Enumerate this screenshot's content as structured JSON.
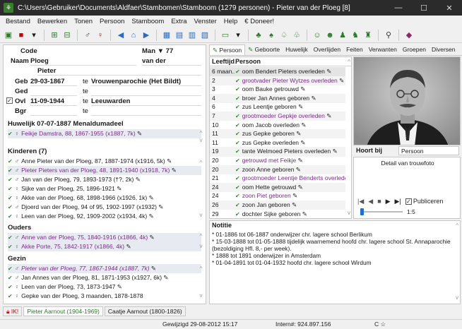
{
  "window": {
    "title": "C:\\Users\\Gebruiker\\Documents\\Aldfaer\\Stambomen\\Stamboom (1279 personen) - Pieter van der Ploeg [8]"
  },
  "menu": [
    "Bestand",
    "Bewerken",
    "Tonen",
    "Persoon",
    "Stamboom",
    "Extra",
    "Venster",
    "Help",
    "€ Doneer!"
  ],
  "person": {
    "code_label": "Code",
    "gender_age": "Man ▼ 77",
    "name_label": "Naam",
    "surname": "Ploeg",
    "prefix": "van der",
    "firstname": "Pieter",
    "birth_label": "Geb",
    "birth_date": "29-03-1867",
    "birth_te": "te",
    "birth_place": "Vrouwenparochie (Het Bildt)",
    "ged_label": "Ged",
    "ged_te": "te",
    "death_label": "Ovl",
    "death_date": "11-09-1944",
    "death_te": "te",
    "death_place": "Leeuwarden",
    "bgr_label": "Bgr",
    "bgr_te": "te"
  },
  "marriage": {
    "heading": "Huwelijk 07-07-1887 Menaldumadeel",
    "partner": "Feikje Damstra, 88, 1867-1955 (x1887, 7k)"
  },
  "children": {
    "heading": "Kinderen (7)",
    "items": [
      "Anne Pieter van der Ploeg, 87, 1887-1974 (x1916, 5k)",
      "Pieter Pieters van der Ploeg, 48, 1891-1940 (x1918, 7k)",
      "Jan van der Ploeg, 79, 1893-1973 (†?, 2k)",
      "Sijke van der Ploeg, 25, 1896-1921",
      "Akke van der Ploeg, 68, 1898-1966 (x1926, 1k)",
      "Djoerd van der Ploeg, 94 of 95, 1902-1997 (x1932)",
      "Leen van der Ploeg, 92, 1909-2002 (x1934, 4k)"
    ]
  },
  "parents": {
    "heading": "Ouders",
    "items": [
      "Anne van der Ploeg, 75, 1840-1916 (x1866, 4k)",
      "Akke Porte, 75, 1842-1917 (x1866, 4k)"
    ]
  },
  "family": {
    "heading": "Gezin",
    "items": [
      "Pieter van der Ploeg, 77, 1867-1944 (x1887, 7k)",
      "Jan Annes van der Ploeg, 81, 1871-1953 (x1927, 6k)",
      "Leen van der Ploeg, 73, 1873-1947",
      "Gepke van der Ploeg, 3 maanden, 1878-1878"
    ]
  },
  "tabs": [
    "Persoon",
    "Geboorte",
    "Huwelijk",
    "Overlijden",
    "Feiten",
    "Verwanten",
    "Groepen",
    "Diversen"
  ],
  "events": {
    "col_age": "Leeftijd",
    "col_person": "Persoon",
    "rows": [
      {
        "age": "6 maan...",
        "text": "oom Bendert Pieters overleden"
      },
      {
        "age": "2",
        "text": "grootvader Pieter Wytzes overleden"
      },
      {
        "age": "3",
        "text": "oom Bauke getrouwd"
      },
      {
        "age": "4",
        "text": "broer Jan Annes geboren"
      },
      {
        "age": "6",
        "text": "zus Leentje geboren"
      },
      {
        "age": "7",
        "text": "grootmoeder Gepkje overleden"
      },
      {
        "age": "10",
        "text": "oom Jacob overleden"
      },
      {
        "age": "11",
        "text": "zus Gepke geboren"
      },
      {
        "age": "11",
        "text": "zus Gepke overleden"
      },
      {
        "age": "19",
        "text": "tante Welmoed Pieters overleden"
      },
      {
        "age": "20",
        "text": "getrouwd met Feikje"
      },
      {
        "age": "20",
        "text": "zoon Anne geboren"
      },
      {
        "age": "21",
        "text": "grootmoeder Leentje Benderts overleden"
      },
      {
        "age": "24",
        "text": "oom Hette getrouwd"
      },
      {
        "age": "24",
        "text": "zoon Piet geboren"
      },
      {
        "age": "26",
        "text": "zoon Jan geboren"
      },
      {
        "age": "29",
        "text": "dochter Sijke geboren"
      }
    ]
  },
  "media": {
    "belongs_label": "Hoort bij",
    "belongs_value": "Persoon",
    "caption": "Detail van trouwfoto",
    "publish_label": "Publiceren",
    "ratio": "1:5"
  },
  "notes": {
    "heading": "Notitie",
    "lines": [
      "* 01-1886 tot 06-1887 onderwijzer chr. lagere school Berlikum",
      "* 15-03-1888 tot 01-05-1888 tijdelijk waarnemend hoofd chr. lagere school St. Annaparochie",
      "(bezoldiging Hfl. 8,- per week).",
      "* 1888 tot 1891 onderwijzer in Amsterdam",
      "* 01-04-1891 tot 01-04-1932 hoofd chr. lagere school Wirdum"
    ]
  },
  "bottom_tabs": [
    "IK!",
    "Pieter Aarnout (1904-1969)",
    "Caatje Aarnout (1800-1826)"
  ],
  "status": {
    "changed": "Gewijzigd 29-08-2012 15:17",
    "intern": "Intern#: 924.897.156",
    "extra": "C ☆"
  }
}
